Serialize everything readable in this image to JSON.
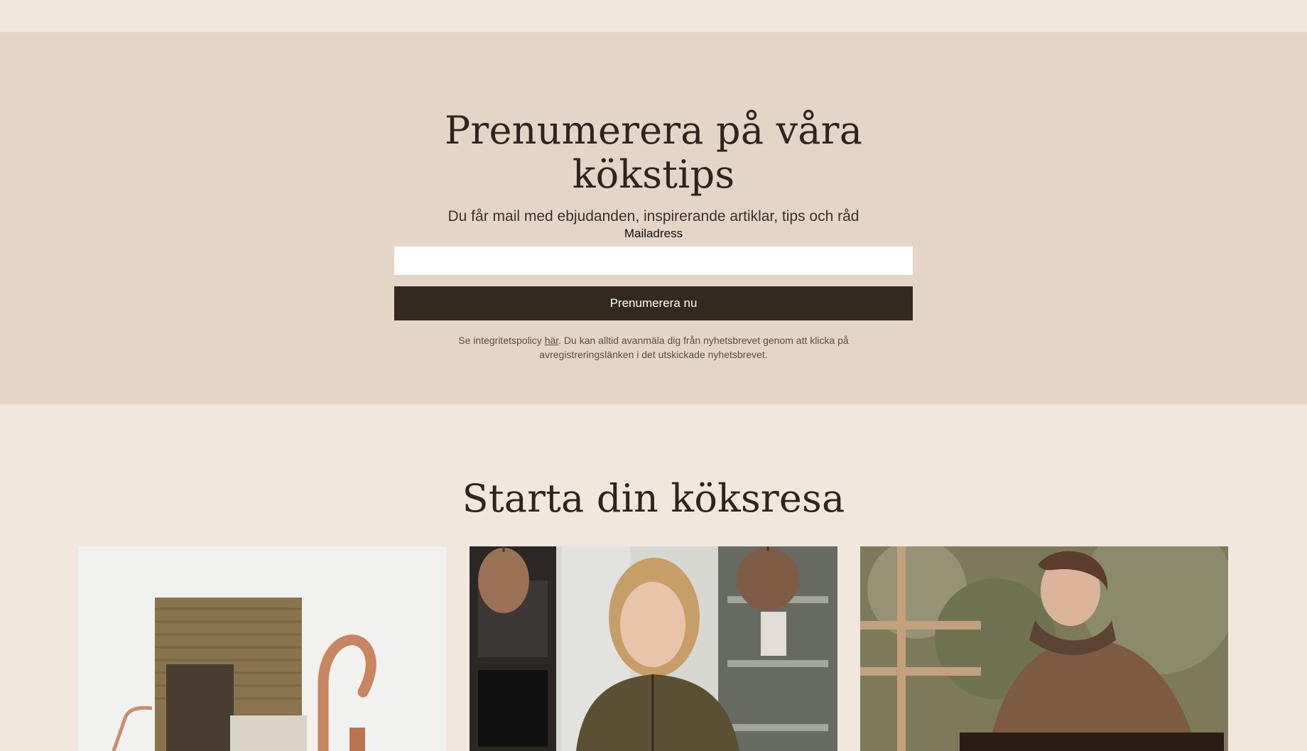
{
  "newsletter": {
    "title": "Prenumerera på våra kökstips",
    "subtitle": "Du får mail med ebjudanden, inspirerande artiklar, tips och råd",
    "email_label": "Mailadress",
    "email_value": "",
    "subscribe_label": "Prenumerera nu",
    "privacy_before": "Se integritetspolicy ",
    "privacy_link": "här",
    "privacy_after": ". Du kan alltid avanmäla dig från nyhetsbrevet genom att klicka på avregistreringslänken i det utskickade nyhetsbrevet."
  },
  "journey": {
    "title": "Starta din köksresa",
    "cards": [
      {
        "image": "kitchen-material-sample-image"
      },
      {
        "image": "kitchen-designer-portrait-image"
      },
      {
        "image": "woman-reading-image"
      }
    ]
  },
  "colors": {
    "page_background": "#f1e7dc",
    "newsletter_background": "#e5d5c6",
    "button_background": "#34291f",
    "button_text": "#ffffff"
  }
}
